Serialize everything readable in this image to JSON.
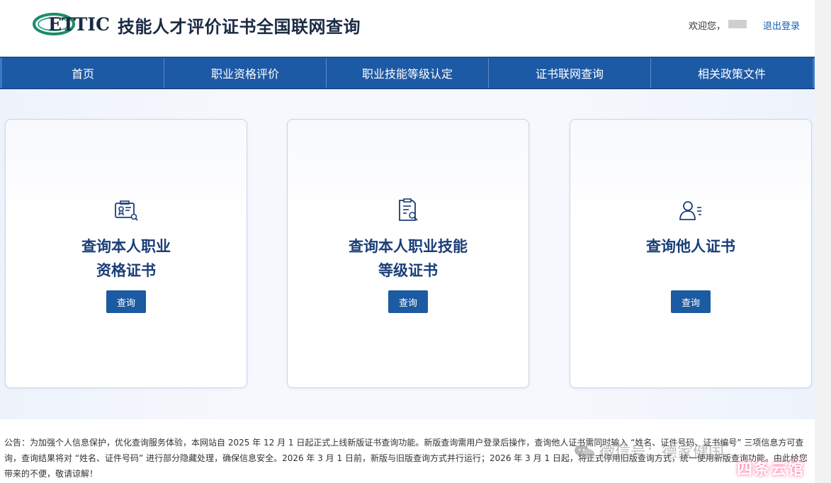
{
  "header": {
    "logo_text": "ETTIC",
    "title": "技能人才评价证书全国联网查询",
    "welcome": "欢迎您，",
    "logout": "退出登录"
  },
  "nav": {
    "items": [
      {
        "label": "首页"
      },
      {
        "label": "职业资格评价"
      },
      {
        "label": "职业技能等级认定"
      },
      {
        "label": "证书联网查询"
      },
      {
        "label": "相关政策文件"
      }
    ]
  },
  "cards": [
    {
      "title_line1": "查询本人职业",
      "title_line2": "资格证书",
      "icon": "certificate-search-icon",
      "button": "查询"
    },
    {
      "title_line1": "查询本人职业技能",
      "title_line2": "等级证书",
      "icon": "document-search-icon",
      "button": "查询"
    },
    {
      "title_line1": "查询他人证书",
      "title_line2": "",
      "icon": "user-list-icon",
      "button": "查询"
    }
  ],
  "notice": {
    "text": "公告：为加强个人信息保护，优化查询服务体验，本网站自 2025 年 12 月 1 日起正式上线新版证书查询功能。新版查询需用户登录后操作，查询他人证书需同时输入 “姓名、证件号码、证书编号” 三项信息方可查询，查询结果将对 “姓名、证件号码” 进行部分隐藏处理，确保信息安全。2026 年 3 月 1 日前，新版与旧版查询方式并行运行；2026 年 3 月 1 日起，将正式停用旧版查询方式，统一使用新版查询功能。由此给您带来的不便，敬请谅解！"
  },
  "watermark": {
    "text": "微信号：德家健国"
  },
  "brand_badge": {
    "text": "四条云馆"
  },
  "colors": {
    "nav_bg": "#1d5aa5",
    "button_bg": "#1c5aa2",
    "card_title": "#1a3e78",
    "logo": "#1f8a6a"
  }
}
